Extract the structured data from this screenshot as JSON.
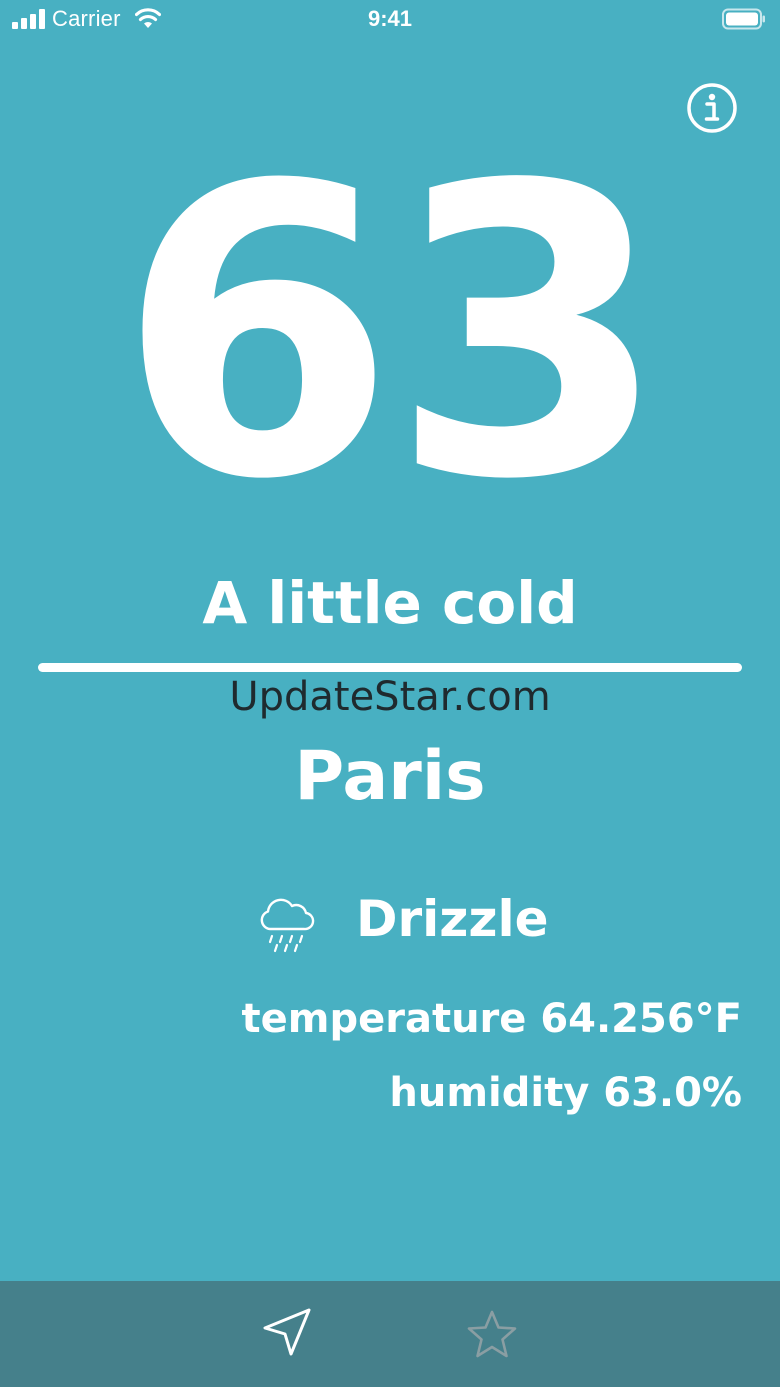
{
  "status_bar": {
    "carrier": "Carrier",
    "time": "9:41",
    "signal_icon": "cellular-signal-icon",
    "wifi_icon": "wifi-icon",
    "battery_icon": "battery-icon"
  },
  "header": {
    "info_icon": "info-icon"
  },
  "main": {
    "temperature_display": "63",
    "feel_label": "A little cold",
    "watermark": "UpdateStar.com",
    "city": "Paris",
    "condition": {
      "icon": "drizzle-cloud-icon",
      "label": "Drizzle"
    },
    "temperature_text": "temperature 64.256°F",
    "humidity_text": "humidity 63.0%"
  },
  "tab_bar": {
    "items": [
      {
        "icon": "location-arrow-icon",
        "selected": true
      },
      {
        "icon": "star-icon",
        "selected": false
      }
    ]
  },
  "colors": {
    "background": "#48b0c2",
    "tab_bar": "#45808b",
    "text": "#ffffff",
    "tab_inactive": "#8a9ea3"
  }
}
